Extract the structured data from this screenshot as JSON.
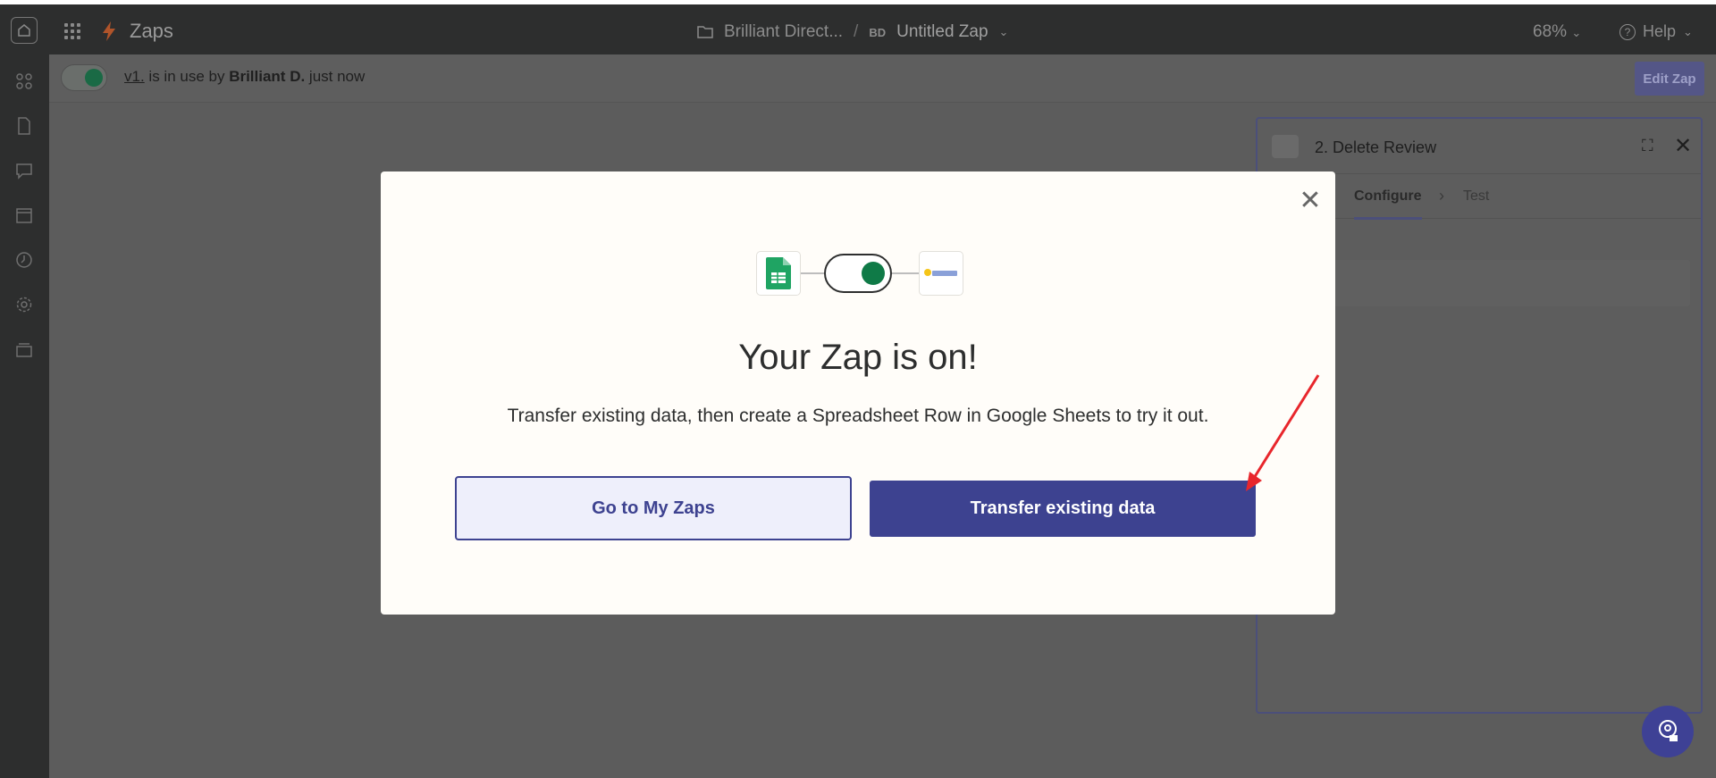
{
  "header": {
    "app_name": "Zaps",
    "breadcrumb_folder": "Brilliant Direct...",
    "breadcrumb_separator": "/",
    "initials": "BD",
    "zap_name": "Untitled Zap",
    "zoom": "68%",
    "help_label": "Help"
  },
  "status": {
    "version_link": "v1.",
    "text_mid": " is in use by ",
    "user": "Brilliant D.",
    "time": " just now",
    "edit_label": "Edit Zap"
  },
  "side_panel": {
    "title": "2. Delete Review",
    "tab_configure": "Configure",
    "tab_test": "Test"
  },
  "modal": {
    "title": "Your Zap is on!",
    "subtitle": "Transfer existing data, then create a Spreadsheet Row in Google Sheets to try it out.",
    "secondary_button": "Go to My Zaps",
    "primary_button": "Transfer existing data"
  },
  "icons": {
    "sheets": "google-sheets-icon",
    "brilliant": "brilliant-directories-icon",
    "close": "close-icon"
  },
  "colors": {
    "primary": "#3d4290",
    "sheets_green": "#1fa463",
    "toggle_on": "#0f7a47",
    "annotation_red": "#e8262c"
  }
}
